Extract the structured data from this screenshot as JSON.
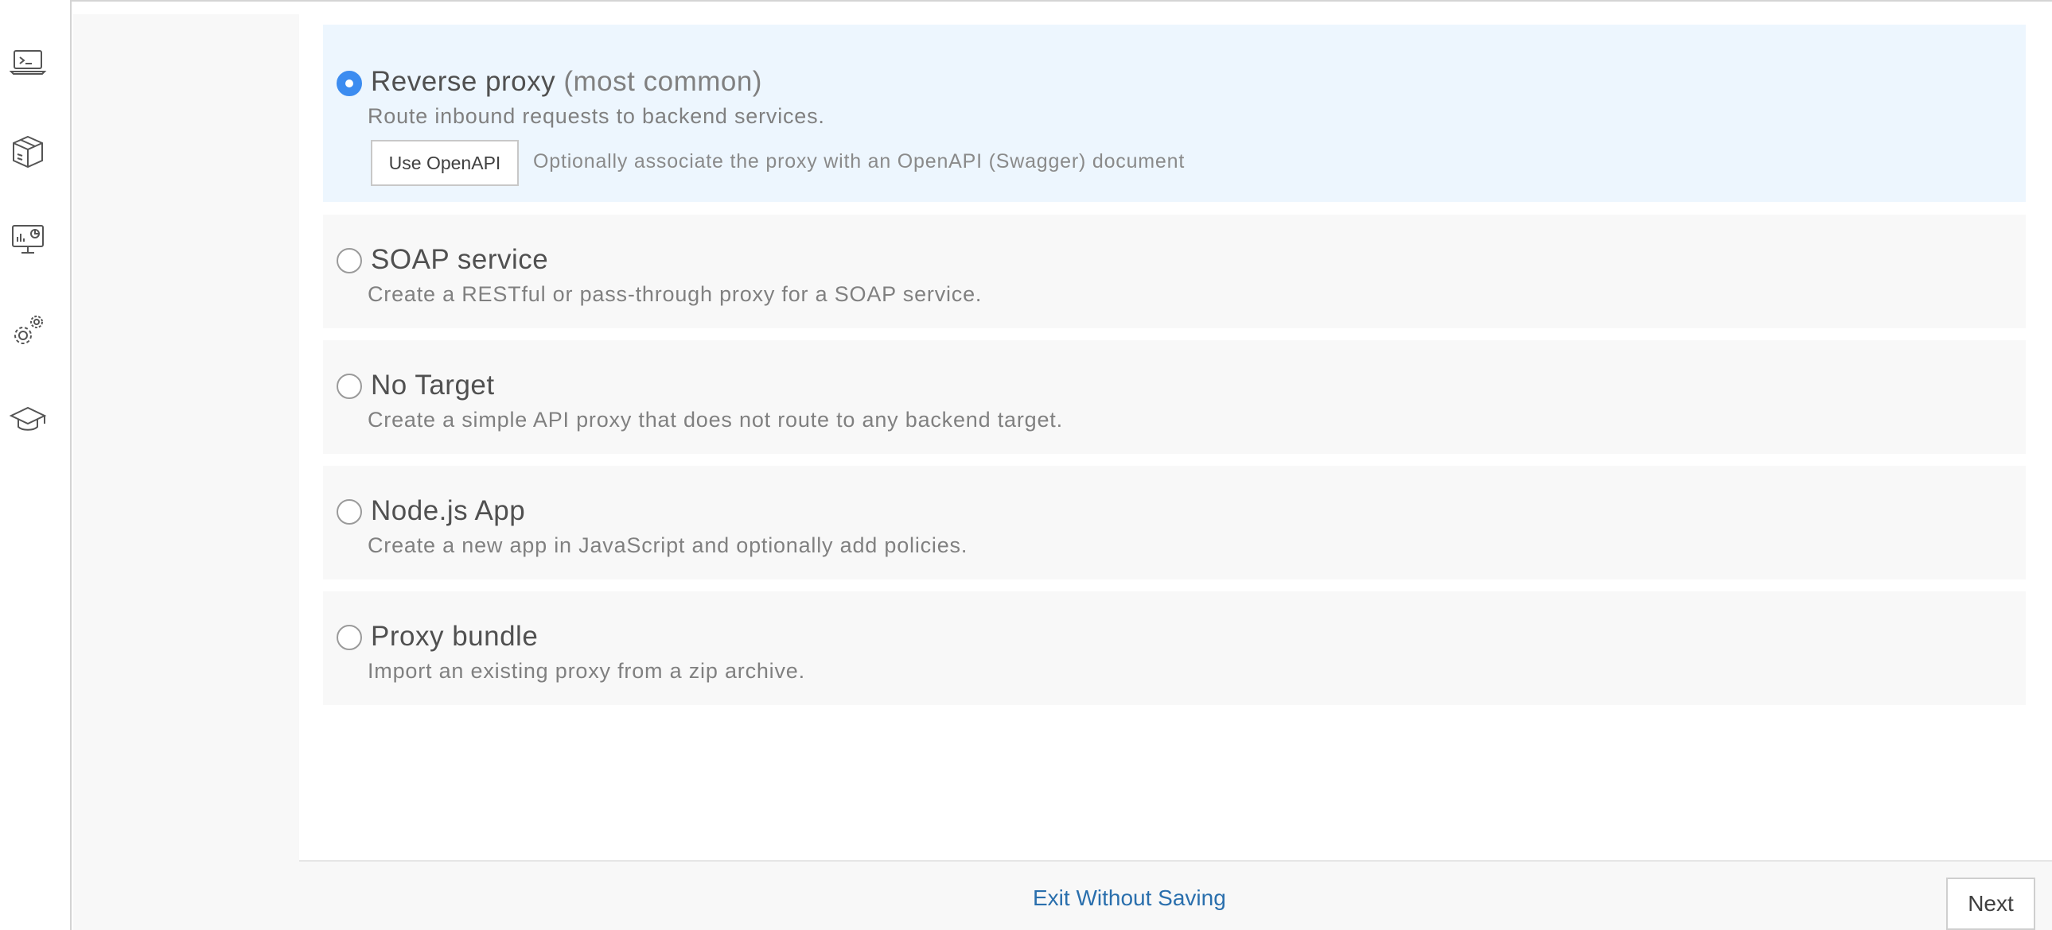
{
  "sidebar": {
    "icons": [
      {
        "name": "terminal-laptop-icon"
      },
      {
        "name": "package-box-icon"
      },
      {
        "name": "monitor-analytics-icon"
      },
      {
        "name": "gears-icon"
      },
      {
        "name": "graduation-cap-icon"
      }
    ]
  },
  "options": [
    {
      "title": "Reverse proxy",
      "title_suffix": "(most common)",
      "description": "Route inbound requests to backend services.",
      "selected": true,
      "openapi_button": "Use OpenAPI",
      "openapi_hint": "Optionally associate the proxy with an OpenAPI (Swagger) document"
    },
    {
      "title": "SOAP service",
      "description": "Create a RESTful or pass-through proxy for a SOAP service.",
      "selected": false
    },
    {
      "title": "No Target",
      "description": "Create a simple API proxy that does not route to any backend target.",
      "selected": false
    },
    {
      "title": "Node.js App",
      "description": "Create a new app in JavaScript and optionally add policies.",
      "selected": false
    },
    {
      "title": "Proxy bundle",
      "description": "Import an existing proxy from a zip archive.",
      "selected": false
    }
  ],
  "footer": {
    "exit_label": "Exit Without Saving",
    "next_label": "Next"
  },
  "colors": {
    "accent": "#3c8cf0",
    "selected_bg": "#edf6fe",
    "link": "#2a6fad"
  }
}
